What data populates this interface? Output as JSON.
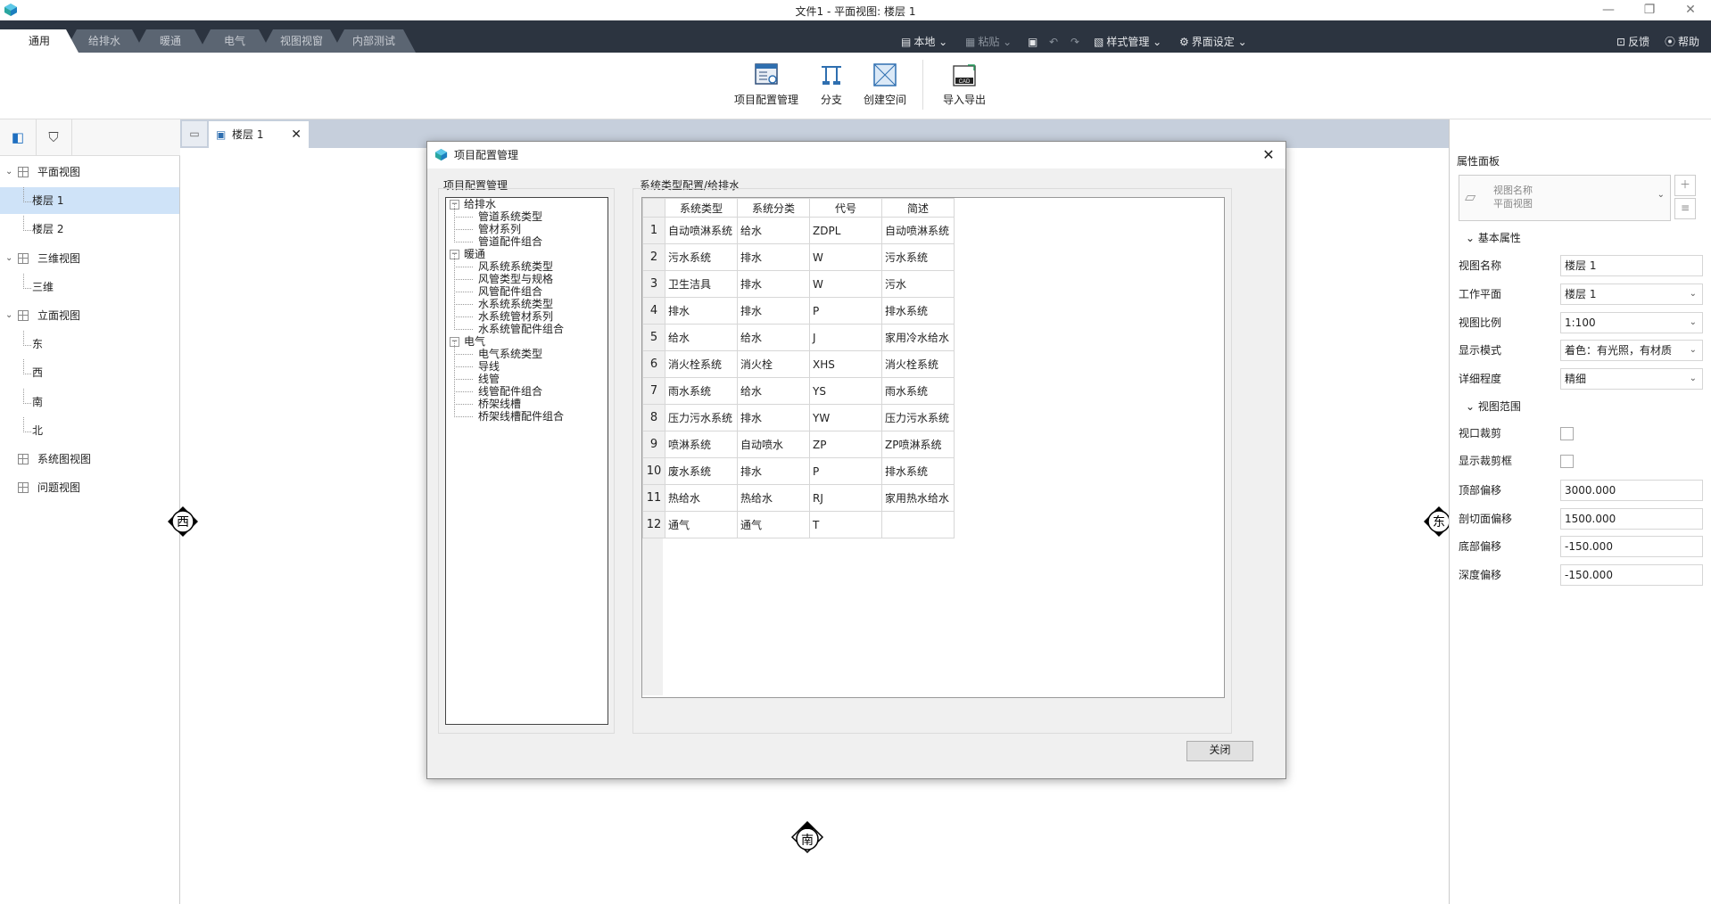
{
  "window": {
    "title": "文件1 - 平面视图: 楼层 1",
    "minimize_icon": "minimize-icon",
    "restore_icon": "restore-icon",
    "close_icon": "close-icon"
  },
  "ribbon_tabs": [
    "通用",
    "给排水",
    "暖通",
    "电气",
    "视图视窗",
    "内部测试"
  ],
  "quick_access": {
    "local": "本地",
    "paste": "粘贴",
    "style_mgmt": "样式管理",
    "ui_settings": "界面设定",
    "feedback": "反馈",
    "help": "帮助"
  },
  "ribbon_buttons": [
    "项目配置管理",
    "分支",
    "创建空间",
    "导入导出"
  ],
  "ribbon_cad_text": "CAD",
  "left_tree": [
    {
      "label": "平面视图",
      "level": 0,
      "expanded": true
    },
    {
      "label": "楼层 1",
      "level": 1,
      "selected": true
    },
    {
      "label": "楼层 2",
      "level": 1
    },
    {
      "label": "三维视图",
      "level": 0,
      "expanded": true
    },
    {
      "label": "三维",
      "level": 1
    },
    {
      "label": "立面视图",
      "level": 0,
      "expanded": true
    },
    {
      "label": "东",
      "level": 1
    },
    {
      "label": "西",
      "level": 1
    },
    {
      "label": "南",
      "level": 1
    },
    {
      "label": "北",
      "level": 1
    },
    {
      "label": "系统图视图",
      "level": 0
    },
    {
      "label": "问题视图",
      "level": 0
    }
  ],
  "doc_tab": {
    "label": "楼层 1"
  },
  "canvas_markers": {
    "west": "西",
    "east": "东",
    "south": "南"
  },
  "properties": {
    "title": "属性面板",
    "view_type": {
      "line1": "视图名称",
      "line2": "平面视图"
    },
    "section_basic": "基本属性",
    "section_range": "视图范围",
    "rows": [
      {
        "label": "视图名称",
        "value": "楼层 1",
        "dropdown": false
      },
      {
        "label": "工作平面",
        "value": "楼层 1",
        "dropdown": true
      },
      {
        "label": "视图比例",
        "value": "1:100",
        "dropdown": true
      },
      {
        "label": "显示模式",
        "value": "着色：有光照，有材质",
        "dropdown": true
      },
      {
        "label": "详细程度",
        "value": "精细",
        "dropdown": true
      }
    ],
    "checks": [
      {
        "label": "视口裁剪",
        "checked": false
      },
      {
        "label": "显示裁剪框",
        "checked": false
      }
    ],
    "range_rows": [
      {
        "label": "顶部偏移",
        "value": "3000.000"
      },
      {
        "label": "剖切面偏移",
        "value": "1500.000"
      },
      {
        "label": "底部偏移",
        "value": "-150.000"
      },
      {
        "label": "深度偏移",
        "value": "-150.000"
      }
    ]
  },
  "dialog": {
    "title": "项目配置管理",
    "left_group_title": "项目配置管理",
    "right_group_title": "系统类型配置/给排水",
    "close_button": "关闭",
    "tree": [
      {
        "label": "给排水",
        "children": [
          "管道系统类型",
          "管材系列",
          "管道配件组合"
        ]
      },
      {
        "label": "暖通",
        "children": [
          "风系统系统类型",
          "风管类型与规格",
          "风管配件组合",
          "水系统系统类型",
          "水系统管材系列",
          "水系统管配件组合"
        ]
      },
      {
        "label": "电气",
        "children": [
          "电气系统类型",
          "导线",
          "线管",
          "线管配件组合",
          "桥架线槽",
          "桥架线槽配件组合"
        ]
      }
    ],
    "table": {
      "columns": [
        "系统类型",
        "系统分类",
        "代号",
        "简述"
      ],
      "rows": [
        [
          "自动喷淋系统",
          "给水",
          "ZDPL",
          "自动喷淋系统"
        ],
        [
          "污水系统",
          "排水",
          "W",
          "污水系统"
        ],
        [
          "卫生洁具",
          "排水",
          "W",
          "污水"
        ],
        [
          "排水",
          "排水",
          "P",
          "排水系统"
        ],
        [
          "给水",
          "给水",
          "J",
          "家用冷水给水"
        ],
        [
          "消火栓系统",
          "消火栓",
          "XHS",
          "消火栓系统"
        ],
        [
          "雨水系统",
          "给水",
          "YS",
          "雨水系统"
        ],
        [
          "压力污水系统",
          "排水",
          "YW",
          "压力污水系统"
        ],
        [
          "喷淋系统",
          "自动喷水",
          "ZP",
          "ZP喷淋系统"
        ],
        [
          "废水系统",
          "排水",
          "P",
          "排水系统"
        ],
        [
          "热给水",
          "热给水",
          "RJ",
          "家用热水给水"
        ],
        [
          "通气",
          "通气",
          "T",
          ""
        ]
      ]
    }
  }
}
